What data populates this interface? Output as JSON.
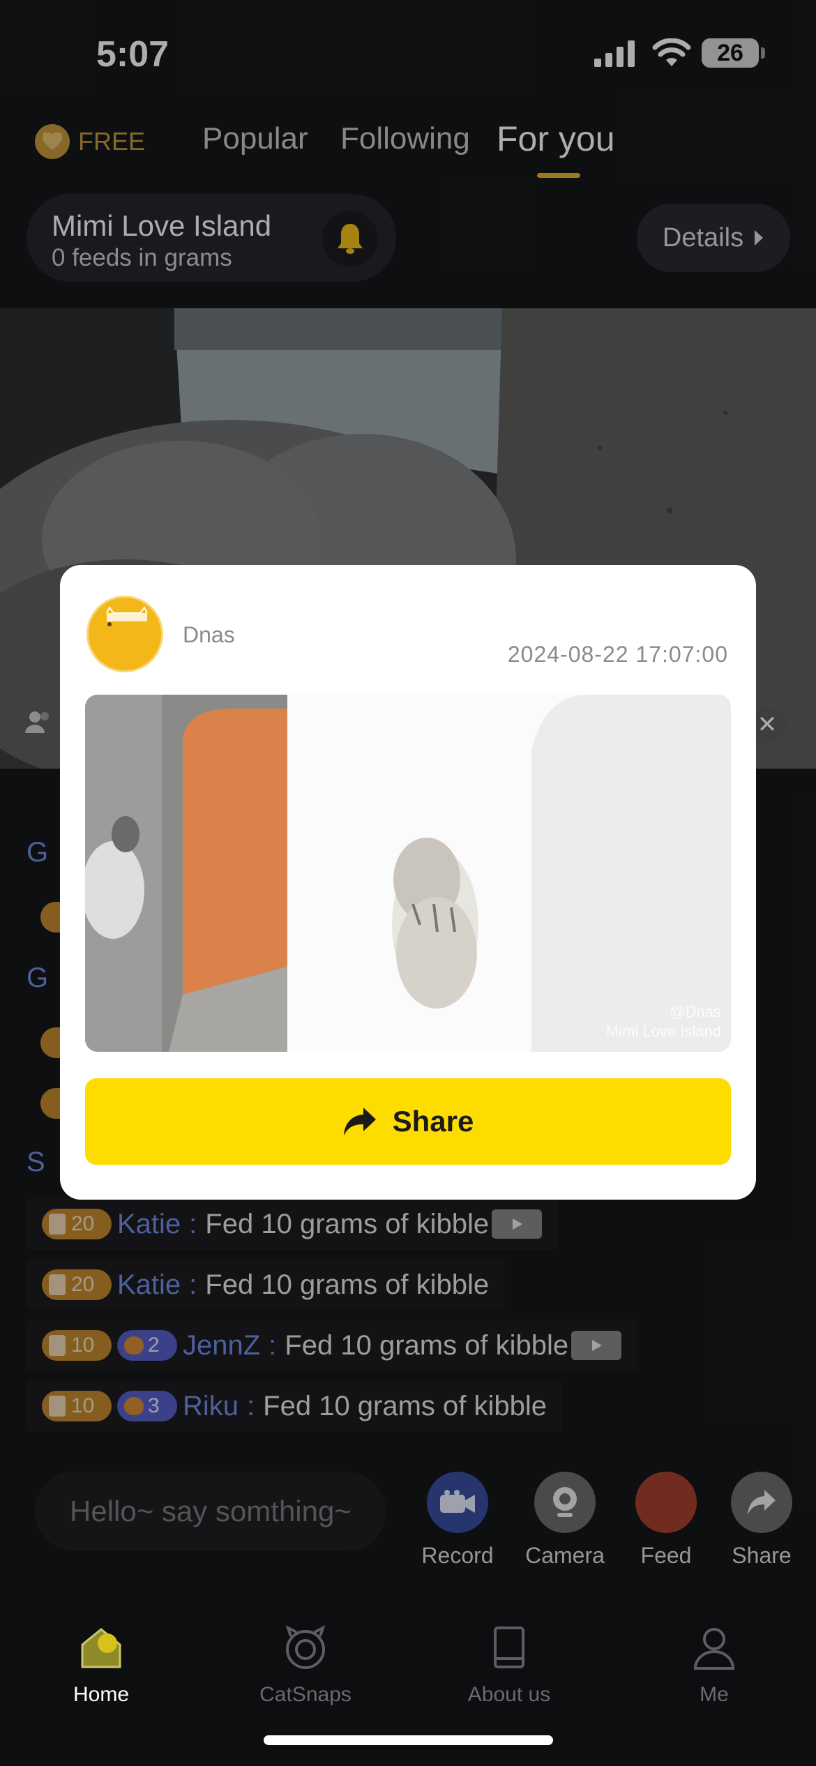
{
  "status_bar": {
    "time": "5:07",
    "battery": "26"
  },
  "top_tabs": {
    "free_label": "FREE",
    "tabs": [
      {
        "label": "Popular",
        "active": false
      },
      {
        "label": "Following",
        "active": false
      },
      {
        "label": "For you",
        "active": true
      }
    ]
  },
  "channel": {
    "title": "Mimi Love Island",
    "subtitle": "0 feeds in grams",
    "details_label": "Details"
  },
  "chat": {
    "stub_letters": [
      "G",
      "G",
      "S"
    ],
    "messages": [
      {
        "gold_badge": "20",
        "blue_badge": "",
        "user": "Katie",
        "text": "Fed 10 grams of kibble",
        "has_video": true
      },
      {
        "gold_badge": "20",
        "blue_badge": "",
        "user": "Katie",
        "text": "Fed 10 grams of kibble",
        "has_video": false
      },
      {
        "gold_badge": "10",
        "blue_badge": "2",
        "user": "JennZ",
        "text": "Fed 10 grams of kibble",
        "has_video": true
      },
      {
        "gold_badge": "10",
        "blue_badge": "3",
        "user": "Riku",
        "text": "Fed 10 grams of kibble",
        "has_video": false
      }
    ],
    "separator": ":"
  },
  "input": {
    "placeholder": "Hello~ say somthing~"
  },
  "actions": [
    {
      "label": "Record",
      "icon": "video-camera-icon",
      "color": "#3a4fa3"
    },
    {
      "label": "Camera",
      "icon": "webcam-icon",
      "color": "#6b6d70"
    },
    {
      "label": "Feed",
      "icon": "feed-icon",
      "color": "#a9402e"
    },
    {
      "label": "Share",
      "icon": "share-icon",
      "color": "#6b6d70"
    }
  ],
  "bottom_nav": [
    {
      "label": "Home",
      "icon": "home-icon",
      "active": true
    },
    {
      "label": "CatSnaps",
      "icon": "catsnaps-icon",
      "active": false
    },
    {
      "label": "About us",
      "icon": "book-icon",
      "active": false
    },
    {
      "label": "Me",
      "icon": "person-icon",
      "active": false
    }
  ],
  "modal": {
    "poster_name": "Dnas",
    "timestamp": "2024-08-22 17:07:00",
    "share_label": "Share",
    "watermark_line1": "@Dnas",
    "watermark_line2": "Mimi Love Island"
  },
  "colors": {
    "accent_yellow": "#ffdc00",
    "username_blue": "#6f8ee6",
    "badge_gold": "#c58a2d",
    "badge_blue": "#5660c9"
  }
}
